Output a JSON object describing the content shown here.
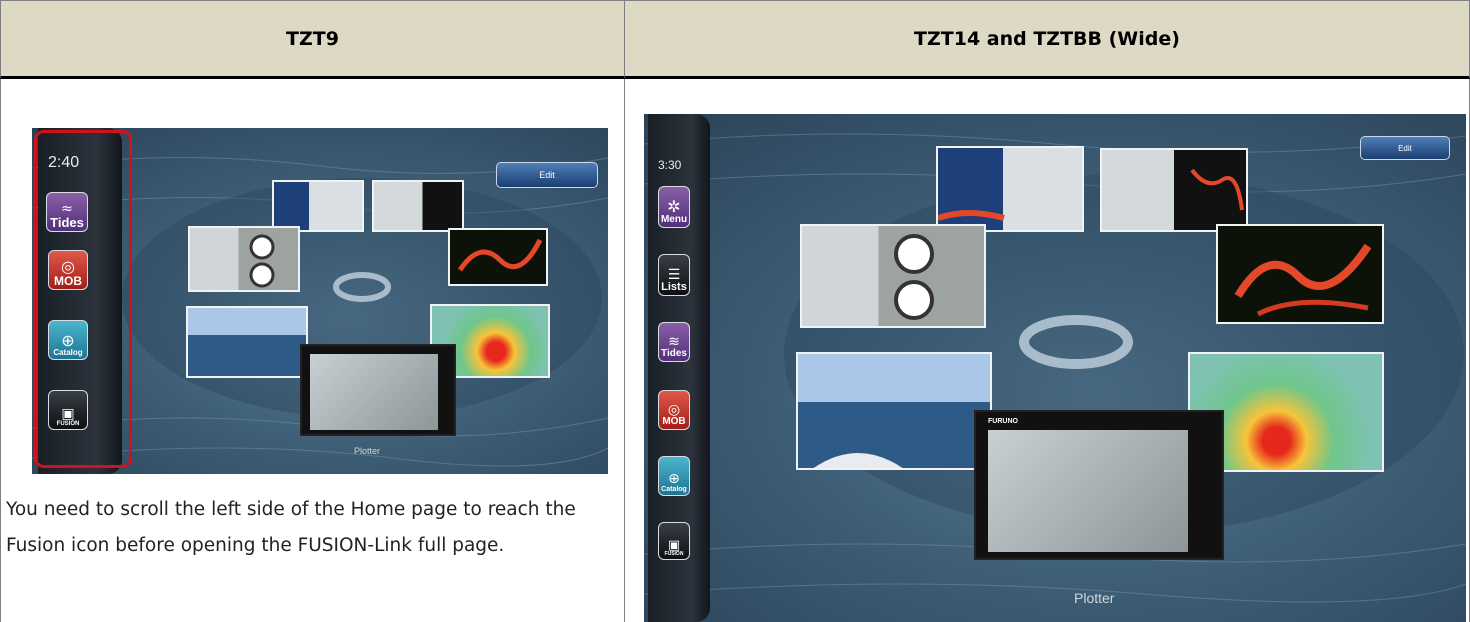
{
  "table": {
    "header_left": "TZT9",
    "header_right": "TZT14 and TZTBB (Wide)"
  },
  "left_screen": {
    "clock": "2:40",
    "icons": [
      "Tides",
      "MOB",
      "Catalog",
      "FUSION"
    ],
    "edit_label": "Edit",
    "bottom_label": "Plotter"
  },
  "right_screen": {
    "clock": "3:30",
    "icons": [
      "Menu",
      "Lists",
      "Tides",
      "MOB",
      "Catalog",
      "FUSION"
    ],
    "edit_label": "Edit",
    "bottom_label": "Plotter",
    "device_brand": "FURUNO"
  },
  "caption": "You need to scroll the left side of the Home page to reach the Fusion icon before opening the FUSION-Link full page."
}
